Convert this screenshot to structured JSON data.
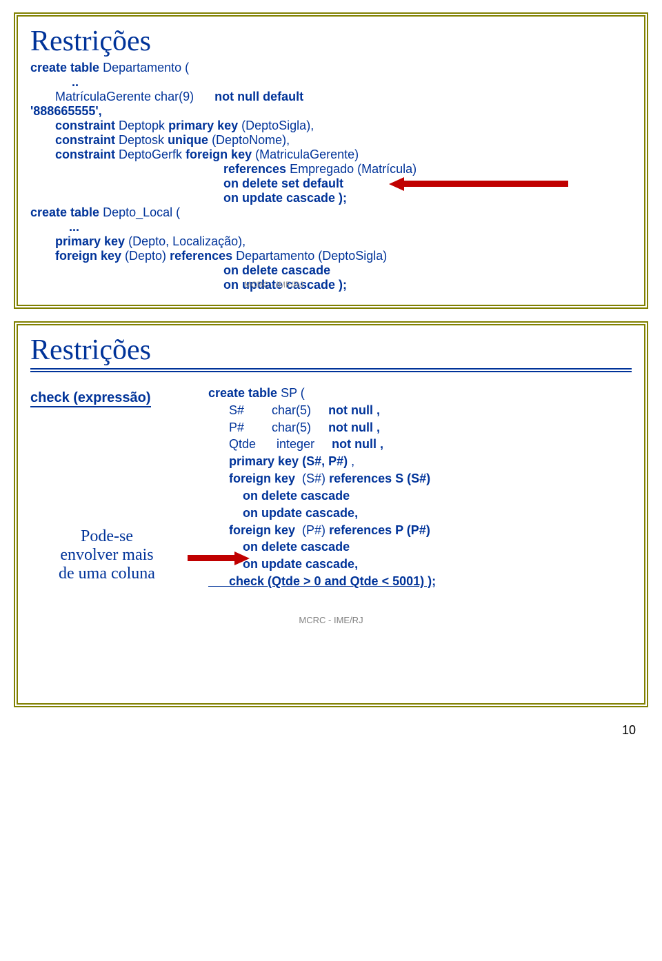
{
  "slide1": {
    "title": "Restrições",
    "line_create": "create table",
    "dept_name": " Departamento (",
    "ellipsis": "..",
    "matricula_line": "MatrículaGerente  char(9)",
    "not_null_default": "not null   default",
    "num": "'888665555',",
    "c1a": "constraint",
    "c1b": " Deptopk  ",
    "c1c": "primary key",
    "c1d": " (DeptoSigla),",
    "c2a": "constraint",
    "c2b": " Deptosk  ",
    "c2c": "unique",
    "c2d": "   (DeptoNome),",
    "c3a": "constraint",
    "c3b": " DeptoGerfk  ",
    "c3c": "foreign key",
    "c3d": " (MatriculaGerente)",
    "ref": "references",
    "emp": " Empregado (Matrícula)",
    "ods": "on delete set default",
    "ouc": "on update cascade );",
    "ct2": "create table",
    "dl": " Depto_Local (",
    "ell2": "...",
    "pk2a": "primary key",
    "pk2b": " (Depto, Localização),",
    "fk2a": "foreign key",
    "fk2b": " (Depto) ",
    "fk2c": "references",
    "fk2d": " Departamento (DeptoSigla)",
    "od": "on delete   cascade",
    "ou": "on update  cascade );",
    "tiny": "MCRC - IME/RJ"
  },
  "slide2": {
    "title": "Restrições",
    "check": "check (expressão)",
    "callout1": "Pode-se",
    "callout2": "envolver mais",
    "callout3": "de uma coluna",
    "ct": "create table",
    "sp": " SP (",
    "r1a": "      S#        char(5)     ",
    "r1b": "not null ,",
    "r2a": "      P#        char(5)     ",
    "r2b": "not null ,",
    "r3a": "      Qtde      integer     ",
    "r3b": "not null ,",
    "pk": "      primary key (S#, P#)",
    "pkc": " ,",
    "fk1a": "      foreign key",
    "fk1b": "  (S#) ",
    "fk1c": "references S (S#)",
    "odc": "          on delete cascade",
    "ouc": "          on update cascade,",
    "fk2a": "      foreign key",
    "fk2b": "  (P#) ",
    "fk2c": "references P (P#)",
    "check_line": "      check (Qtde > 0 and Qtde < 5001) );",
    "footer": "MCRC - IME/RJ"
  },
  "page_number": "10"
}
